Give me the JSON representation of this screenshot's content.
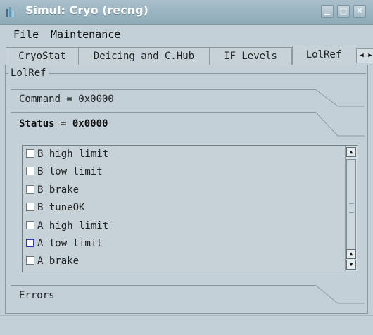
{
  "window": {
    "title": "Simul: Cryo (recng)",
    "icon": "app-icon",
    "controls": [
      "minimize-icon",
      "maximize-icon",
      "close-icon"
    ]
  },
  "menubar": {
    "file": "File",
    "maintenance": "Maintenance"
  },
  "tabs": [
    "CryoStat",
    "Deicing and C.Hub",
    "IF Levels",
    "LolRef"
  ],
  "active_tab": "LolRef",
  "group": {
    "title": "LolRef"
  },
  "command": {
    "label": "Command = 0x0000"
  },
  "status": {
    "label": "Status = 0x0000"
  },
  "checklist": [
    {
      "label": "B high limit",
      "checked": false
    },
    {
      "label": "B low limit",
      "checked": false
    },
    {
      "label": "B brake",
      "checked": false
    },
    {
      "label": "B tuneOK",
      "checked": false
    },
    {
      "label": "A high limit",
      "checked": false
    },
    {
      "label": "A low limit",
      "checked": false,
      "focused": true
    },
    {
      "label": "A brake",
      "checked": false
    }
  ],
  "errors": {
    "label": "Errors"
  },
  "colors": {
    "titlebar": "#9bb4c1",
    "window_bg": "#c3d0d7",
    "focus": "#2f34a0"
  }
}
